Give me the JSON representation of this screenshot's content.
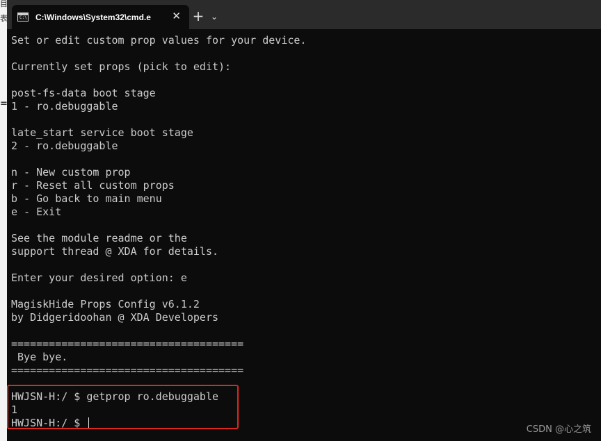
{
  "window": {
    "tab_title": "C:\\Windows\\System32\\cmd.e",
    "tab_icon_text": "C:\\",
    "close_glyph": "✕",
    "new_tab_glyph": "+",
    "dropdown_glyph": "⌄"
  },
  "background": {
    "marks": [
      "目",
      "表",
      "="
    ]
  },
  "terminal": {
    "lines": [
      "Set or edit custom prop values for your device.",
      "",
      "Currently set props (pick to edit):",
      "",
      "post-fs-data boot stage",
      "1 - ro.debuggable",
      "",
      "late_start service boot stage",
      "2 - ro.debuggable",
      "",
      "n - New custom prop",
      "r - Reset all custom props",
      "b - Go back to main menu",
      "e - Exit",
      "",
      "See the module readme or the",
      "support thread @ XDA for details.",
      "",
      "Enter your desired option: e",
      "",
      "MagiskHide Props Config v6.1.2",
      "by Didgeridoohan @ XDA Developers",
      "",
      "=====================================",
      " Bye bye.",
      "=====================================",
      "",
      "HWJSN-H:/ $ getprop ro.debuggable",
      "1",
      "HWJSN-H:/ $ "
    ]
  },
  "watermark": "CSDN @心之筑",
  "colors": {
    "terminal_bg": "#0c0c0c",
    "terminal_fg": "#cccccc",
    "titlebar_bg": "#2b2b2b",
    "highlight_border": "#e0271c"
  }
}
